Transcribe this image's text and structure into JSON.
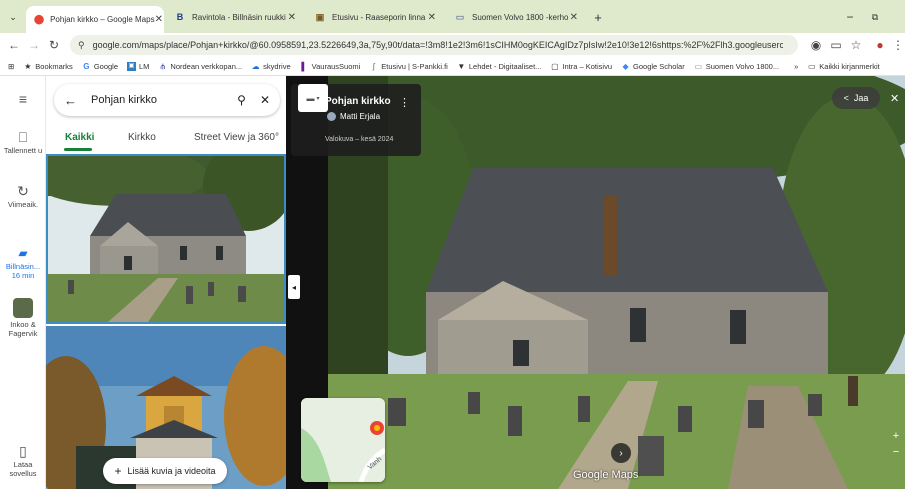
{
  "browser": {
    "tabs": [
      {
        "label": "Pohjan kirkko – Google Maps",
        "active": true
      },
      {
        "label": "Ravintola - Billnäsin ruukki"
      },
      {
        "label": "Etusivu - Raaseporin linna"
      },
      {
        "label": "Suomen Volvo 1800 -kerho"
      }
    ],
    "new_tab": "+",
    "url": "google.com/maps/place/Pohjan+kirkko/@60.0958591,23.5226649,3a,75y,90t/data=!3m8!1e2!3m6!1sCIHM0ogKEICAgIDz7pIsIw!2e10!3e12!6shttps:%2F%2Flh3.googleusercontent.com%2Fgp...",
    "bookmarks": [
      "Bookmarks",
      "Google",
      "LM",
      "Nordean verkkopan...",
      "skydrive",
      "VaurausSuomi",
      "Etusivu | S-Pankki.fi",
      "Lehdet - Digitaaliset...",
      "Intra – Kotisivu",
      "Google Scholar",
      "Suomen Volvo 1800...",
      "Kaikki kirjanmerkit"
    ],
    "more_bookmarks": "»"
  },
  "rail": {
    "items": [
      {
        "label": "Tallennett u",
        "icon": "bookmark-icon"
      },
      {
        "label": "Viimeaik.",
        "icon": "history-icon"
      },
      {
        "label": "Billnäsin... 16 min",
        "icon": "car-icon"
      },
      {
        "label": "Inkoo & Fagervik",
        "icon": "place-thumbnail"
      },
      {
        "label": "Lataa sovellus",
        "icon": "phone-icon"
      }
    ]
  },
  "panel": {
    "search_value": "Pohjan kirkko",
    "tabs": [
      "Kaikki",
      "Kirkko",
      "Street View ja 360°"
    ],
    "add_photos": "Lisää kuvia ja videoita"
  },
  "streetview": {
    "place": "Pohjan kirkko",
    "author": "Matti Erjala",
    "caption": "Valokuva – kesä 2024",
    "share": "Jaa",
    "watermark": "Google Maps",
    "map_label": "Vanh"
  }
}
